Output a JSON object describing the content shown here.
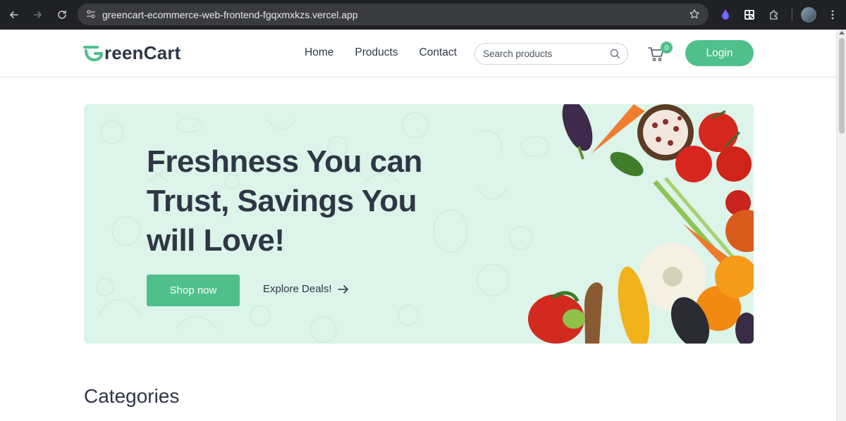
{
  "browser": {
    "url": "greencart-ecommerce-web-frontend-fgqxmxkzs.vercel.app",
    "icons": [
      "back-icon",
      "forward-icon",
      "reload-icon",
      "site-info-icon",
      "star-icon",
      "extension-icon",
      "qr-icon",
      "puzzle-icon",
      "profile-avatar"
    ]
  },
  "header": {
    "logo_text": "reenCart",
    "nav": [
      {
        "label": "Home"
      },
      {
        "label": "Products"
      },
      {
        "label": "Contact"
      }
    ],
    "search_placeholder": "Search products",
    "cart_count": "0",
    "login_label": "Login"
  },
  "hero": {
    "title": "Freshness You can Trust, Savings You will Love!",
    "shop_label": "Shop now",
    "explore_label": "Explore Deals!"
  },
  "categories": {
    "title": "Categories"
  },
  "colors": {
    "accent": "#4fbf8b",
    "hero_bg": "#dcf4ea",
    "text_dark": "#2f3746"
  }
}
